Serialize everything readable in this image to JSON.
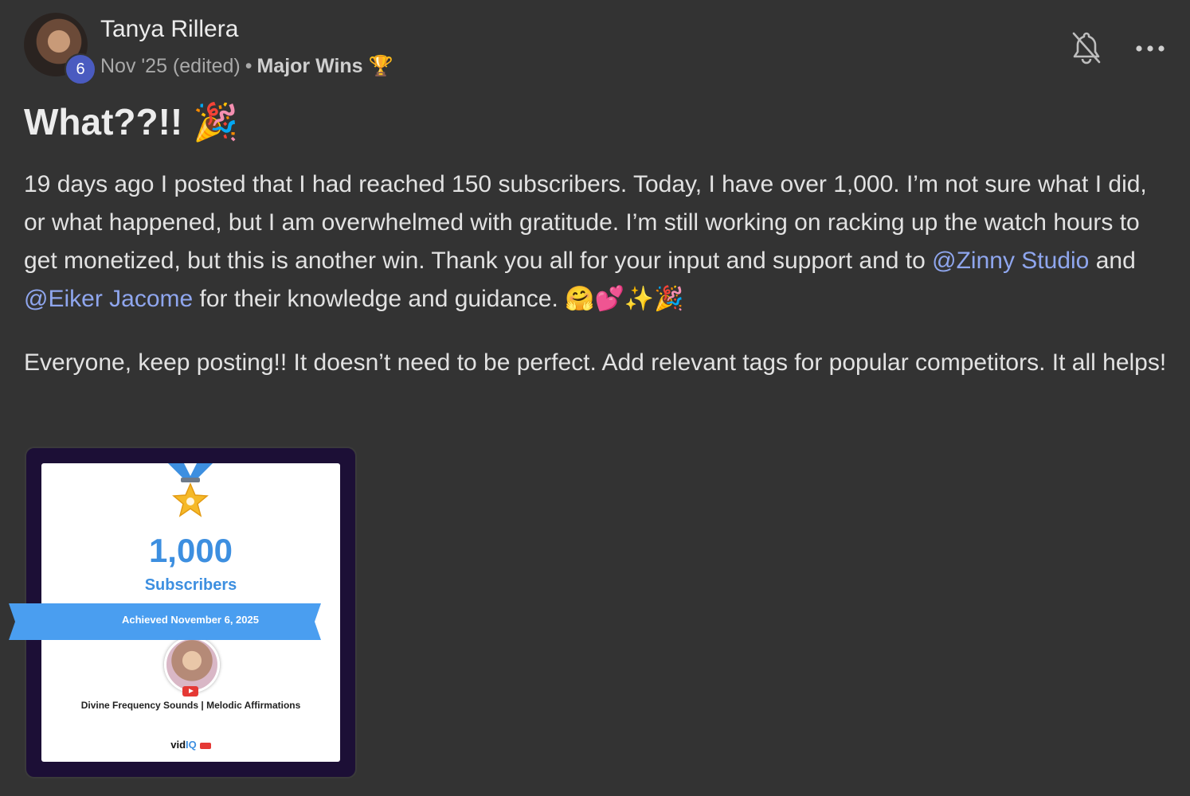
{
  "author": {
    "name": "Tanya Rillera",
    "level": "6",
    "date": "Nov '25 (edited)",
    "separator": "•",
    "category": "Major Wins",
    "category_emoji": "🏆"
  },
  "post": {
    "title": "What??!!",
    "title_emoji": "🎉",
    "paragraph1_part1": "19 days ago I posted that I had reached 150 subscribers. Today, I have over 1,000. I’m not sure what I did, or what happened, but I am overwhelmed with gratitude. I’m still working on racking up the watch hours to get monetized, but this is another win. Thank you all for your input and support and to ",
    "mention1": "@Zinny Studio",
    "paragraph1_and": " and ",
    "mention2": "@Eiker Jacome",
    "paragraph1_part2": " for their knowledge and guidance. ",
    "paragraph1_emojis": "🤗💕✨🎉",
    "paragraph2": "Everyone, keep posting!! It doesn’t need to be perfect. Add relevant tags for popular competitors. It all helps!"
  },
  "attachment": {
    "count": "1,000",
    "count_label": "Subscribers",
    "achieved": "Achieved November 6, 2025",
    "channel": "Divine Frequency Sounds | Melodic Affirmations",
    "brand_vid": "vid",
    "brand_iq": "IQ"
  },
  "colors": {
    "background": "#333333",
    "mention": "#8fa6ee",
    "level_badge": "#4a5bc0",
    "card_accent": "#3d8fe0",
    "attachment_bg": "#1c0f36"
  },
  "icons": {
    "bell": "bell-off-icon",
    "more": "more-horizontal-icon"
  }
}
